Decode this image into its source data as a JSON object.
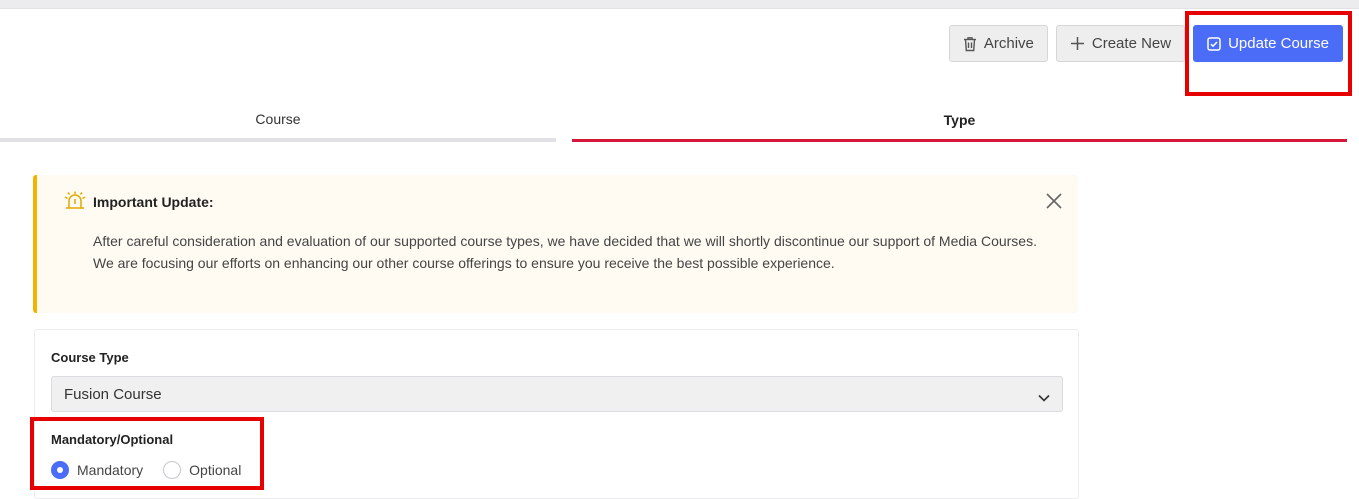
{
  "toolbar": {
    "archive_label": "Archive",
    "create_new_label": "Create New",
    "update_course_label": "Update Course"
  },
  "tabs": [
    {
      "label": "Course",
      "active": false
    },
    {
      "label": "Type",
      "active": true
    }
  ],
  "alert": {
    "title": "Important Update:",
    "line1": "After careful consideration and evaluation of our supported course types, we have decided that we will shortly discontinue our support of Media Courses.",
    "line2": "We are focusing our efforts on enhancing our other course offerings to ensure you receive the best possible experience."
  },
  "form": {
    "course_type_label": "Course Type",
    "course_type_value": "Fusion Course",
    "mandatory_optional_label": "Mandatory/Optional",
    "options": [
      {
        "label": "Mandatory",
        "checked": true
      },
      {
        "label": "Optional",
        "checked": false
      }
    ]
  },
  "colors": {
    "primary": "#4a6cf7",
    "active_tab_underline": "#d6173c",
    "alert_accent": "#f2b400",
    "highlight": "#e60000"
  }
}
